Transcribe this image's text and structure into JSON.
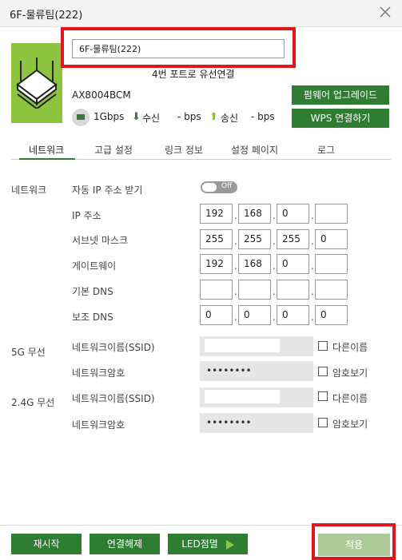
{
  "window": {
    "title": "6F-물류팀(222)"
  },
  "header": {
    "name_value": "6F-물류팀(222)",
    "status": "4번 포트로 유선연결",
    "model": "AX8004BCM",
    "link_speed": "1Gbps",
    "rx_label": "수신",
    "rx_value": "- bps",
    "tx_label": "송신",
    "tx_value": "- bps",
    "firmware_button": "펌웨어 업그레이드",
    "wps_button": "WPS 연결하기"
  },
  "tabs": [
    {
      "label": "네트워크",
      "active": true
    },
    {
      "label": "고급 설정",
      "active": false
    },
    {
      "label": "링크 정보",
      "active": false
    },
    {
      "label": "설정 페이지",
      "active": false
    },
    {
      "label": "로그",
      "active": false
    }
  ],
  "network": {
    "section_label": "네트워크",
    "auto_ip_label": "자동 IP 주소 받기",
    "auto_ip_toggle": "Off",
    "ip_label": "IP 주소",
    "ip": [
      "192",
      "168",
      "0",
      ""
    ],
    "subnet_label": "서브넷 마스크",
    "subnet": [
      "255",
      "255",
      "255",
      "0"
    ],
    "gateway_label": "게이트웨이",
    "gateway": [
      "192",
      "168",
      "0",
      ""
    ],
    "dns1_label": "기본 DNS",
    "dns1": [
      "",
      "",
      "",
      ""
    ],
    "dns2_label": "보조 DNS",
    "dns2": [
      "0",
      "0",
      "0",
      "0"
    ]
  },
  "wireless_5g": {
    "section_label": "5G 무선",
    "ssid_label": "네트워크이름(SSID)",
    "ssid_checkbox": "다른이름",
    "password_label": "네트워크암호",
    "password_value": "••••••••",
    "password_checkbox": "암호보기"
  },
  "wireless_24g": {
    "section_label": "2.4G 무선",
    "ssid_label": "네트워크이름(SSID)",
    "ssid_checkbox": "다른이름",
    "password_label": "네트워크암호",
    "password_value": "••••••••",
    "password_checkbox": "암호보기"
  },
  "footer": {
    "restart": "재시작",
    "disconnect": "연결해제",
    "led": "LED점멸",
    "apply": "적용"
  },
  "colors": {
    "accent_green": "#2f7d32",
    "light_green": "#8cc43f",
    "highlight_red": "#e0161d",
    "apply_disabled": "#aec99a"
  }
}
